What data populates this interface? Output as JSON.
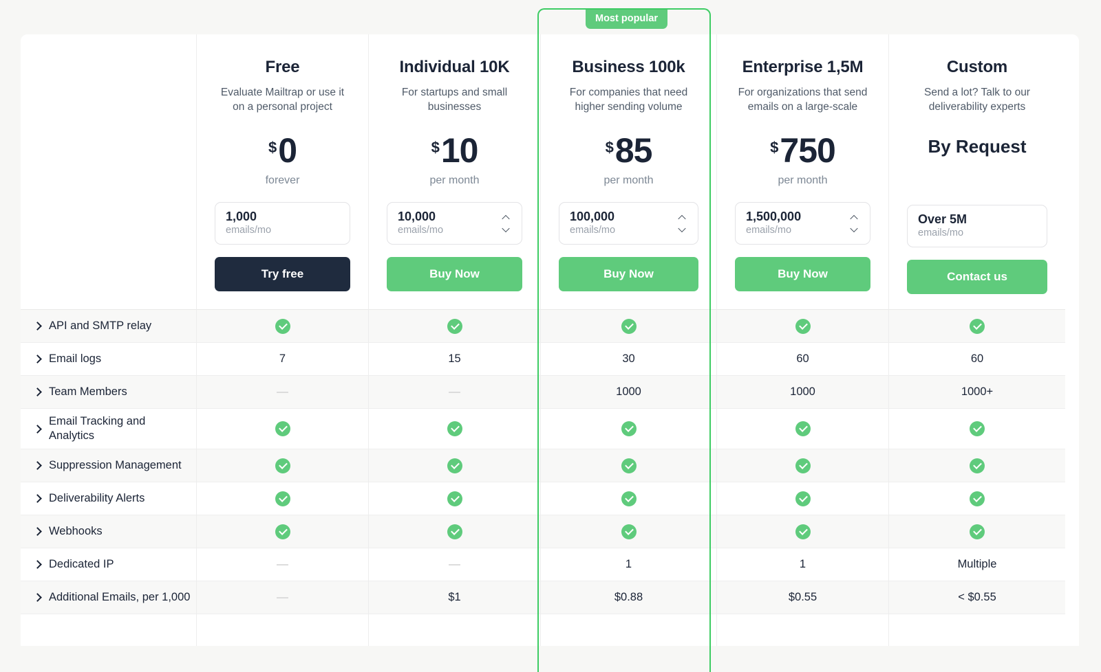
{
  "badge": {
    "label": "Most popular"
  },
  "plans": [
    {
      "name": "Free",
      "desc": "Evaluate Mailtrap or use it on a personal project",
      "currency": "$",
      "amount": "0",
      "period": "forever",
      "stepper_value": "1,000",
      "stepper_unit": "emails/mo",
      "has_stepper_chevrons": false,
      "cta": "Try free",
      "cta_style": "dark"
    },
    {
      "name": "Individual 10K",
      "desc": "For startups and small businesses",
      "currency": "$",
      "amount": "10",
      "period": "per month",
      "stepper_value": "10,000",
      "stepper_unit": "emails/mo",
      "has_stepper_chevrons": true,
      "cta": "Buy Now",
      "cta_style": "green"
    },
    {
      "name": "Business 100k",
      "desc": "For companies that need higher sending volume",
      "currency": "$",
      "amount": "85",
      "period": "per month",
      "stepper_value": "100,000",
      "stepper_unit": "emails/mo",
      "has_stepper_chevrons": true,
      "cta": "Buy Now",
      "cta_style": "green",
      "highlighted": true
    },
    {
      "name": "Enterprise 1,5M",
      "desc": "For organizations that send emails on a large-scale",
      "currency": "$",
      "amount": "750",
      "period": "per month",
      "stepper_value": "1,500,000",
      "stepper_unit": "emails/mo",
      "has_stepper_chevrons": true,
      "cta": "Buy Now",
      "cta_style": "green"
    },
    {
      "name": "Custom",
      "desc": "Send a lot? Talk to our deliverability experts",
      "currency": "",
      "amount": "",
      "period": "",
      "by_request": "By Request",
      "stepper_value": "Over 5M",
      "stepper_unit": "emails/mo",
      "has_stepper_chevrons": false,
      "cta": "Contact us",
      "cta_style": "green"
    }
  ],
  "features": [
    {
      "label": "API and SMTP relay",
      "values": [
        "check",
        "check",
        "check",
        "check",
        "check"
      ]
    },
    {
      "label": "Email logs",
      "values": [
        "7",
        "15",
        "30",
        "60",
        "60"
      ]
    },
    {
      "label": "Team Members",
      "values": [
        "dash",
        "dash",
        "1000",
        "1000",
        "1000+"
      ]
    },
    {
      "label": "Email Tracking and Analytics",
      "values": [
        "check",
        "check",
        "check",
        "check",
        "check"
      ]
    },
    {
      "label": "Suppression Management",
      "values": [
        "check",
        "check",
        "check",
        "check",
        "check"
      ]
    },
    {
      "label": "Deliverability Alerts",
      "values": [
        "check",
        "check",
        "check",
        "check",
        "check"
      ]
    },
    {
      "label": "Webhooks",
      "values": [
        "check",
        "check",
        "check",
        "check",
        "check"
      ]
    },
    {
      "label": "Dedicated IP",
      "values": [
        "dash",
        "dash",
        "1",
        "1",
        "Multiple"
      ]
    },
    {
      "label": "Additional Emails, per 1,000",
      "values": [
        "dash",
        "$1",
        "$0.88",
        "$0.55",
        "< $0.55"
      ]
    }
  ],
  "colors": {
    "accent_green": "#5fcb7c",
    "highlight_border": "#3dcc63",
    "dark_button": "#1f2b3e",
    "text_dark": "#1b2436",
    "text_muted": "#7c8794",
    "page_bg": "#f7f7f5"
  }
}
